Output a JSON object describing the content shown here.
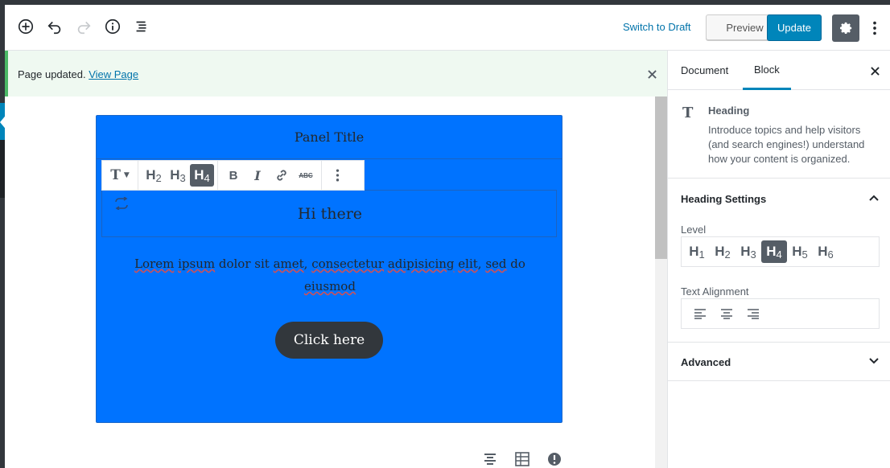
{
  "header": {
    "switch_to_draft": "Switch to Draft",
    "preview": "Preview",
    "update": "Update"
  },
  "notice": {
    "text": "Page updated.",
    "link": "View Page"
  },
  "editor": {
    "panel_title": "Panel Title",
    "heading": "Hi there",
    "paragraph": {
      "words": [
        "Lorem",
        " ",
        "ipsum",
        " dolor sit ",
        "amet",
        ", ",
        "consectetur",
        " ",
        "adipisicing",
        " ",
        "elit",
        ", ",
        "sed",
        " do ",
        "eiusmod"
      ]
    },
    "button": "Click here",
    "toolbar": {
      "h2": "H",
      "h2_sub": "2",
      "h3": "H",
      "h3_sub": "3",
      "h4": "H",
      "h4_sub": "4"
    }
  },
  "sidebar": {
    "tabs": [
      "Document",
      "Block"
    ],
    "active_tab": "Block",
    "block": {
      "title": "Heading",
      "description": "Introduce topics and help visitors (and search engines!) understand how your content is organized."
    },
    "heading_settings": {
      "title": "Heading Settings",
      "level_label": "Level",
      "levels": [
        "1",
        "2",
        "3",
        "4",
        "5",
        "6"
      ],
      "active_level": "4",
      "alignment_label": "Text Alignment"
    },
    "advanced": "Advanced"
  },
  "colors": {
    "panel_bg": "#0073ff",
    "update_btn": "#0085ba",
    "notice_bg": "#eff9f1",
    "notice_border": "#4ab866"
  }
}
